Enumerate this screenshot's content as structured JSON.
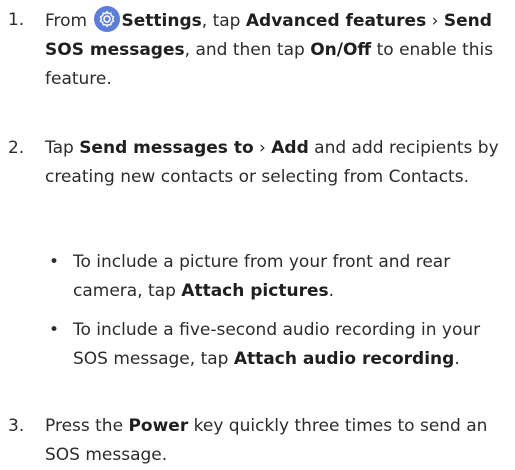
{
  "step1": {
    "num": "1.",
    "prefix": "From ",
    "settings": "Settings",
    "t1": ", tap ",
    "advanced": "Advanced features",
    "sep": " › ",
    "send_sos": "Send SOS messages",
    "t2": ", and then tap ",
    "onoff": "On/Off",
    "t3": " to enable this feature.",
    "icon": "settings-gear-icon",
    "icon_color": "#5b7ed9"
  },
  "step2": {
    "num": "2.",
    "t1": "Tap ",
    "send_to": "Send messages to",
    "sep": " › ",
    "add": "Add",
    "t2": " and add recipients by creating new contacts or selecting from Contacts."
  },
  "bullets": [
    {
      "dot": "•",
      "t1": "To include a picture from your front and rear camera, tap ",
      "bold": "Attach pictures",
      "t2": "."
    },
    {
      "dot": "•",
      "t1": "To include a five-second audio recording in your SOS message, tap ",
      "bold": "Attach audio recording",
      "t2": "."
    }
  ],
  "step3": {
    "num": "3.",
    "t1": "Press the ",
    "power": "Power",
    "t2": " key quickly three times to send an SOS message."
  }
}
